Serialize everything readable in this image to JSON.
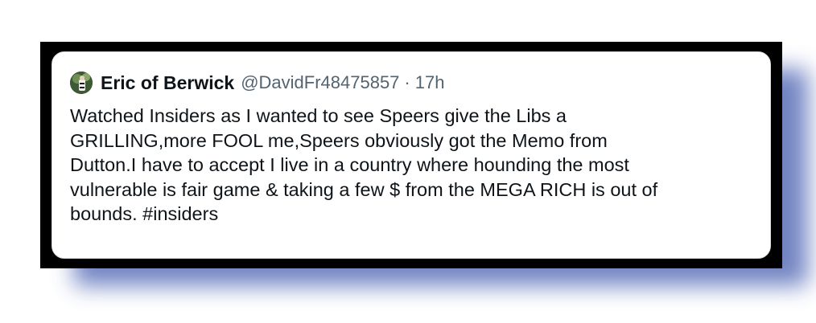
{
  "tweet": {
    "display_name": "Eric of Berwick",
    "handle": "@DavidFr48475857",
    "separator": "·",
    "time": "17h",
    "avatar_icon": "user-avatar-icon",
    "text": "Watched Insiders as I wanted to see Speers give the Libs a\nGRILLING,more FOOL me,Speers obviously got the Memo from\nDutton.I have to accept I live in a country where hounding the most\nvulnerable is fair game & taking a few $ from the MEGA RICH is out of\nbounds. #insiders"
  },
  "colors": {
    "frame": "#000000",
    "shadow": "#5a6fb8",
    "name": "#0f1419",
    "meta": "#536471",
    "card_border": "#d9dde2"
  }
}
